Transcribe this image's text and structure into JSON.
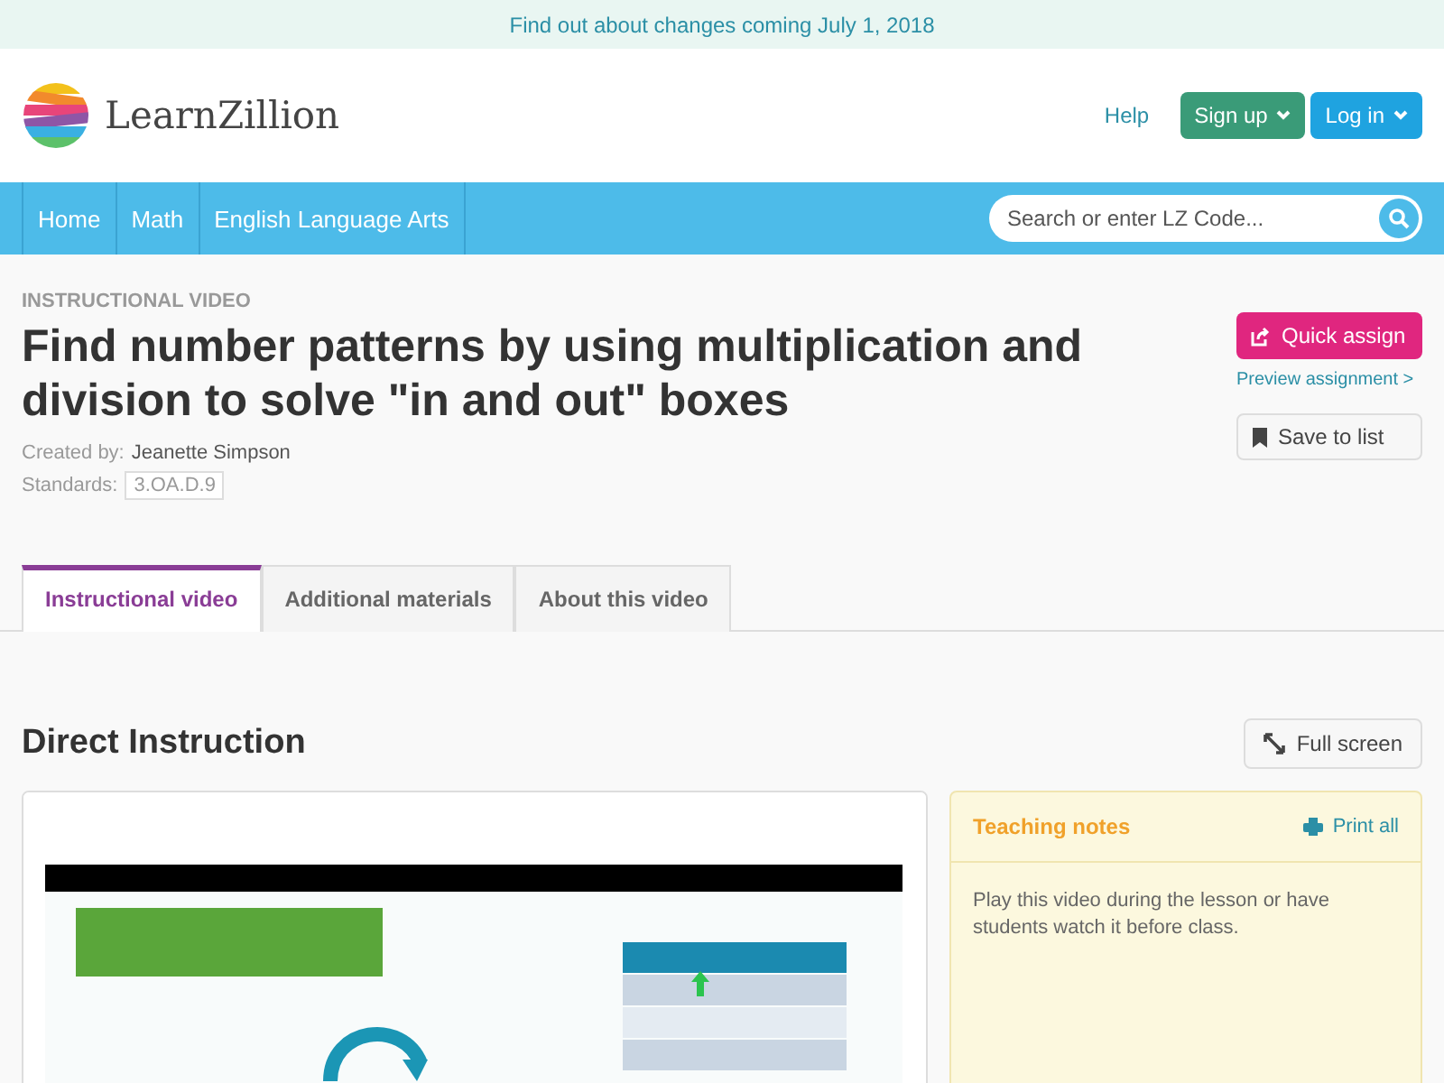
{
  "banner": {
    "text": "Find out about changes coming July 1, 2018"
  },
  "header": {
    "logo": "LearnZillion",
    "help": "Help",
    "buttons": [
      {
        "label": "Sign up",
        "kind": "signup"
      },
      {
        "label": "Log in",
        "kind": "login"
      }
    ]
  },
  "nav": {
    "items": [
      "Home",
      "Math",
      "English Language Arts"
    ],
    "search": {
      "placeholder": "Search or enter LZ Code..."
    }
  },
  "lesson": {
    "eyebrow": "INSTRUCTIONAL VIDEO",
    "title": "Find number patterns by using multiplication and division to solve \"in and out\" boxes",
    "created_label": "Created by:",
    "author": "Jeanette Simpson",
    "standards_label": "Standards:",
    "standard": "3.OA.D.9",
    "quick_assign": "Quick assign",
    "preview": "Preview assignment >",
    "save": "Save to list"
  },
  "tabs": [
    {
      "label": "Instructional video",
      "selected": true
    },
    {
      "label": "Additional materials",
      "selected": false
    },
    {
      "label": "About this video",
      "selected": false
    }
  ],
  "section": {
    "title": "Direct Instruction",
    "full_screen": "Full screen"
  },
  "notes": {
    "title": "Teaching notes",
    "print": "Print all",
    "text": "Play this video during the lesson or have students watch it before class."
  }
}
